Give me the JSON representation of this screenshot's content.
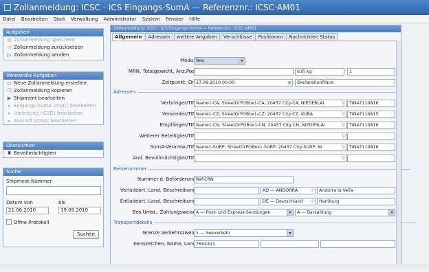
{
  "title": "Zollanmeldung: ICSC - ICS Eingangs-SumA — Referenznr.: ICSC-AM01",
  "menu": [
    "Datei",
    "Bearbeiten",
    "Start",
    "Verwaltung",
    "Administrator",
    "System",
    "Fenster",
    "Hilfe"
  ],
  "tasks": {
    "header": "Aufgaben",
    "items": [
      {
        "label": "Zollanmeldung speichern",
        "icon": "save-icon",
        "enabled": false
      },
      {
        "label": "Zollanmeldung zurücksetzen",
        "icon": "reset-icon",
        "enabled": true
      },
      {
        "label": "Zollanmeldung senden",
        "icon": "send-icon",
        "enabled": true
      }
    ]
  },
  "related": {
    "header": "Verwandte Aufgaben",
    "items": [
      {
        "label": "Neue Zollanmeldung erstellen",
        "icon": "new-document-icon",
        "enabled": true
      },
      {
        "label": "Zollanmeldung kopieren",
        "icon": "copy-icon",
        "enabled": true
      },
      {
        "label": "Shipment bearbeiten",
        "icon": "shipment-icon",
        "enabled": true
      },
      {
        "label": "Eingangs-SumA (ICSC) bearbeiten",
        "icon": "edit-icon",
        "enabled": false
      },
      {
        "label": "Umleitung (ICSD) bearbeiten",
        "icon": "edit-icon",
        "enabled": false
      },
      {
        "label": "Ankunft (ICSA) bearbeiten",
        "icon": "edit-icon",
        "enabled": false
      }
    ]
  },
  "overview": {
    "header": "Übersichten",
    "items": [
      {
        "label": "Bevollmächtigten",
        "icon": "overview-icon",
        "enabled": true
      }
    ]
  },
  "search": {
    "header": "Suche",
    "shipment_label": "Shipment-Nummer",
    "shipment_value": "",
    "date_from_label": "Datum von",
    "date_to_label": "bis",
    "date_from": "21.06.2010",
    "date_to": "19.09.2010",
    "protocol_label": "Offne Protokoll",
    "search_button": "Suchen"
  },
  "main": {
    "header": "Zollanmeldung: ICSC - ICS Eingangs-SumA — Referenznr.: ICSC-AM01",
    "tabs": [
      "Allgemein",
      "Adressen",
      "weitere Angaben",
      "Verschlüsse",
      "Positionen",
      "Nachrichten Status"
    ],
    "active_tab": "Allgemein",
    "modus_label": "Modus",
    "modus_value": "Neu",
    "mrn_label": "MRN, Totalgewicht, Anz.Pos.",
    "mrn_value": "",
    "weight_value": "630 kg",
    "count_value": "1",
    "time_label": "Zeitpunkt, Ort",
    "time_value": "27.08.2010 00:00",
    "place_value": "DeclarationPlace",
    "addr_section": "Adressen",
    "addresses": [
      {
        "label": "Verbringer/TIN",
        "value": "Name1-CA, StreetOrPOBox1-CA, 20457 City-CA, NIEDERLAI",
        "tin": "TIN47110816"
      },
      {
        "label": "Versender/TIN",
        "value": "Name1-CZ, StreetOrPOBox1-CZ, 20457 City-CZ, KUBA",
        "tin": "TIN47110815"
      },
      {
        "label": "Empfänger/TIN",
        "value": "Name1-CN, StreetOrPOBox1-CN, 20457 City-CN, NIEDERLAI",
        "tin": "TIN47110816"
      },
      {
        "label": "Weiterer Beteiligter/TIN",
        "value": "",
        "tin": ""
      },
      {
        "label": "SumA-Verantw./TIN",
        "value": "Name1-SURP, StreetOrPOBox1-SURP, 20457 City-SURP, NI",
        "tin": "TIN47110816"
      },
      {
        "label": "And. Bevollmächtigter/TIN",
        "value": "",
        "tin": ""
      }
    ],
    "trip_section": "Reisenummer",
    "transport_no_label": "Nummer d. Beförderung",
    "transport_no_value": "Ref-CRN",
    "loading_label": "Verladeort, Land, Beschreibung",
    "loading_place": "",
    "loading_country": "AD — ANDORRA",
    "loading_desc": "Andorra la Vella",
    "unloading_label": "Entladeort, Land, Beschreibung",
    "unloading_place": "",
    "unloading_country": "DE — Deutschland",
    "unloading_desc": "Hamburg",
    "payment_label": "Bes.Umst., Zahlungsweise",
    "payment_circ": "A — Post- und Express-Sendungen",
    "payment_method": "A — Barzahlung",
    "transport_section": "Transportdetails",
    "border_label": "Grenze Verkehrszweig",
    "border_value": "1 — Seeverkehr",
    "plate_label": "Kennzeichen, Name, Land",
    "plate_value": "7654321",
    "plate_name": "",
    "plate_country": ""
  },
  "colors": {
    "title_bar": "#2d63a8",
    "panel_header": "#4d7dbf",
    "section_text": "#2f5fa8"
  }
}
